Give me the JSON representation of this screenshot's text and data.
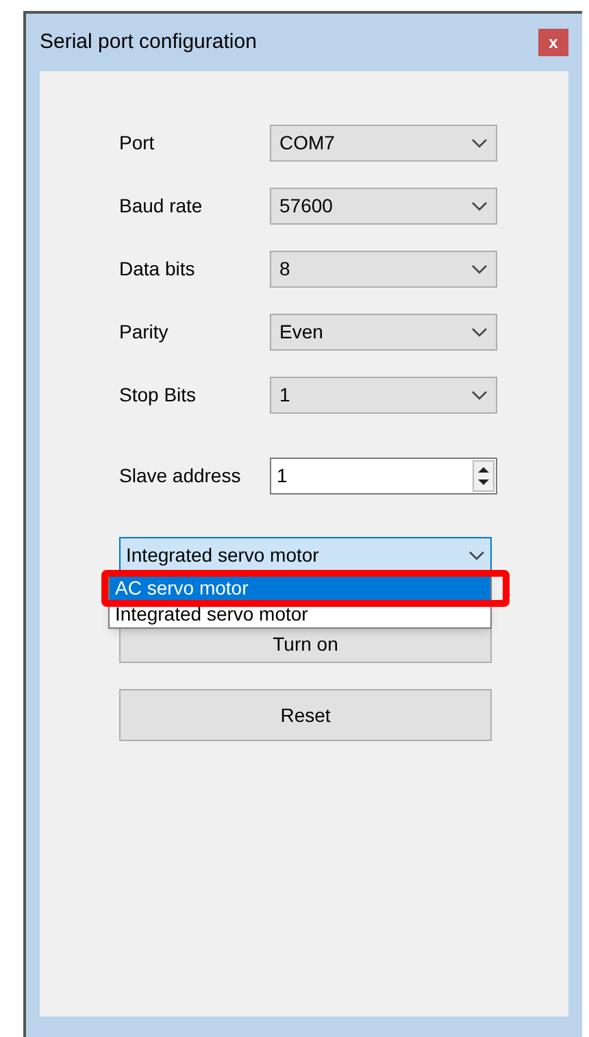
{
  "window": {
    "title": "Serial port configuration",
    "close_label": "x"
  },
  "fields": [
    {
      "label": "Port",
      "value": "COM7"
    },
    {
      "label": "Baud rate",
      "value": "57600"
    },
    {
      "label": "Data bits",
      "value": "8"
    },
    {
      "label": "Parity",
      "value": "Even"
    },
    {
      "label": "Stop Bits",
      "value": "1"
    }
  ],
  "slave_address": {
    "label": "Slave address",
    "value": "1"
  },
  "motor_type": {
    "value": "Integrated servo motor",
    "expanded": true,
    "options": [
      {
        "label": "AC servo motor",
        "hovered": true,
        "annotated": true
      },
      {
        "label": "Integrated servo motor",
        "hovered": false,
        "annotated": false
      }
    ]
  },
  "buttons": [
    "Turn on",
    "Reset"
  ]
}
